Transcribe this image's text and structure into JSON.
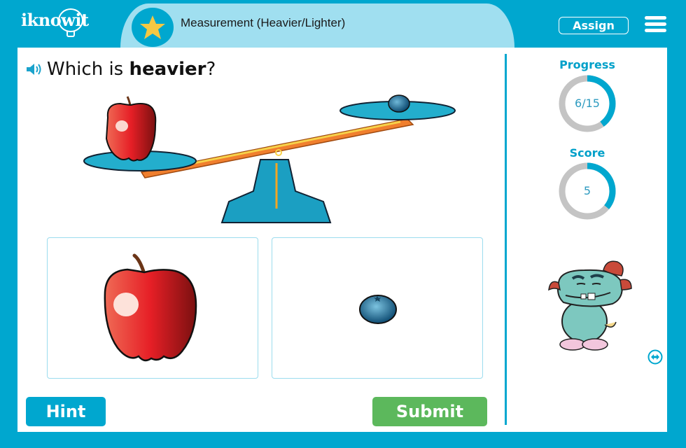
{
  "header": {
    "logo_text": "iknowit",
    "lesson_title": "Measurement (Heavier/Lighter)",
    "lesson_icon": "star-icon",
    "assign_label": "Assign",
    "menu_icon": "hamburger-menu-icon"
  },
  "question": {
    "prefix": "Which is ",
    "emphasis": "heavier",
    "suffix": "?",
    "audio_icon": "speaker-icon"
  },
  "illustration": {
    "description": "balance scale tipped down on the apple side",
    "left_pan_item": "apple",
    "right_pan_item": "blueberry"
  },
  "answers": [
    {
      "id": "apple",
      "label": "apple"
    },
    {
      "id": "blueberry",
      "label": "blueberry"
    }
  ],
  "buttons": {
    "hint_label": "Hint",
    "submit_label": "Submit"
  },
  "sidebar": {
    "progress": {
      "label": "Progress",
      "text": "6/15",
      "current": 6,
      "total": 15
    },
    "score": {
      "label": "Score",
      "text": "5",
      "fraction_shown": 0.36
    },
    "mascot": "monster-mascot",
    "toggle_icon": "swap-arrows-icon"
  },
  "colors": {
    "brand_blue": "#00a7cf",
    "title_pill": "#a0dff0",
    "star_yellow": "#f5c842",
    "submit_green": "#5cb85c",
    "ring_gray": "#c4c4c4",
    "card_border": "#9bdcee"
  }
}
